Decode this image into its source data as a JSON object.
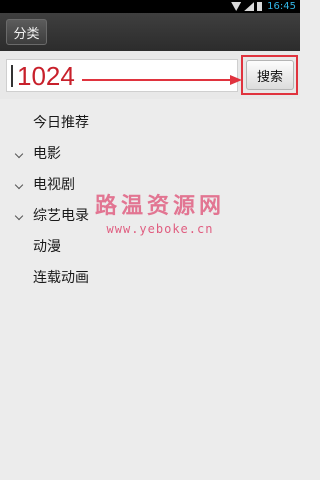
{
  "status_bar": {
    "time": "16:45"
  },
  "header": {
    "category_button_label": "分类"
  },
  "search": {
    "value": "1024",
    "button_label": "搜索"
  },
  "categories": [
    {
      "label": "今日推荐",
      "has_chevron": false
    },
    {
      "label": "电影",
      "has_chevron": true
    },
    {
      "label": "电视剧",
      "has_chevron": true
    },
    {
      "label": "综艺电录",
      "has_chevron": true
    },
    {
      "label": "动漫",
      "has_chevron": false
    },
    {
      "label": "连载动画",
      "has_chevron": false
    }
  ],
  "watermark": {
    "title": "路温资源网",
    "url": "www.yeboke.cn"
  },
  "colors": {
    "annotation_red": "#e0333e",
    "status_clock": "#33b5e5",
    "watermark": "#dc2e5c"
  }
}
